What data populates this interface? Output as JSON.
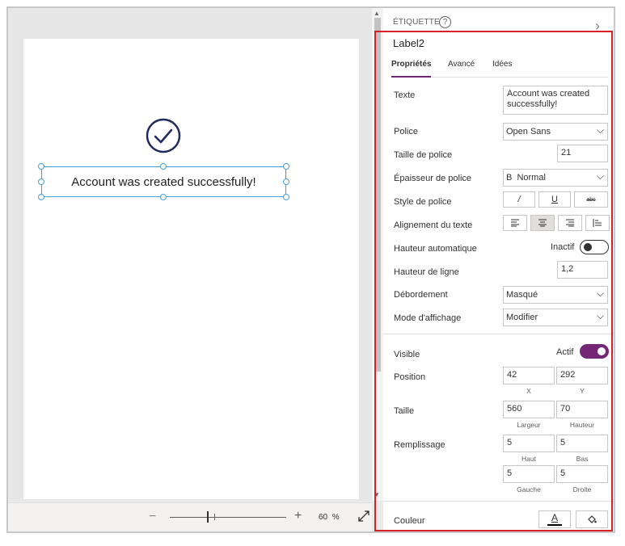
{
  "canvas": {
    "label_text": "Account was created successfully!",
    "zoom": {
      "value": "60",
      "unit": "%",
      "minus": "−",
      "plus": "+"
    }
  },
  "panel": {
    "header": "ÉTIQUETTE",
    "help": "?",
    "control_name": "Label2",
    "tabs": [
      "Propriétés",
      "Avancé",
      "Idées"
    ],
    "active_tab": "Propriétés",
    "text": {
      "label": "Texte",
      "value": "Account was created successfully!"
    },
    "font": {
      "label": "Police",
      "value": "Open Sans"
    },
    "font_size": {
      "label": "Taille de police",
      "value": "21"
    },
    "font_weight": {
      "label": "Épaisseur de police",
      "value": "B  Normal"
    },
    "font_style": {
      "label": "Style de police",
      "italic": "/",
      "underline": "U",
      "strike": "abc"
    },
    "text_align": {
      "label": "Alignement du texte",
      "selected": "center"
    },
    "auto_height": {
      "label": "Hauteur automatique",
      "state": "Inactif"
    },
    "line_height": {
      "label": "Hauteur de ligne",
      "value": "1,2"
    },
    "overflow": {
      "label": "Débordement",
      "value": "Masqué"
    },
    "display_mode": {
      "label": "Mode d'affichage",
      "value": "Modifier"
    },
    "visible": {
      "label": "Visible",
      "state": "Actif"
    },
    "position": {
      "label": "Position",
      "x": "42",
      "y": "292",
      "x_label": "X",
      "y_label": "Y"
    },
    "size": {
      "label": "Taille",
      "width": "560",
      "height": "70",
      "width_label": "Largeur",
      "height_label": "Hauteur"
    },
    "padding": {
      "label": "Remplissage",
      "top": "5",
      "bottom": "5",
      "left": "5",
      "right": "5",
      "top_label": "Haut",
      "bottom_label": "Bas",
      "left_label": "Gauche",
      "right_label": "Droite"
    },
    "color": {
      "label": "Couleur",
      "text_color_glyph": "A"
    }
  },
  "colors": {
    "accent": "#742774",
    "selection": "#4a9fd8",
    "highlight": "#d92027"
  }
}
